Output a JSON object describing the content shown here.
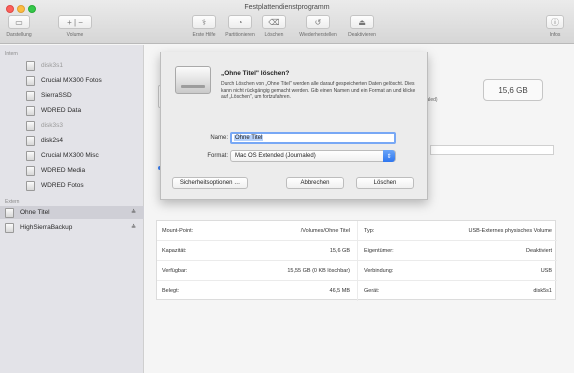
{
  "window": {
    "title": "Festplattendienstprogramm"
  },
  "toolbar": {
    "left": [
      {
        "name": "darstellung",
        "label": "Darstellung",
        "icon": "sidebar-icon"
      },
      {
        "name": "volume",
        "label": "Volume",
        "icon": "plus-minus-icon"
      }
    ],
    "center": [
      {
        "name": "erste-hilfe",
        "label": "Erste Hilfe",
        "icon": "stethoscope-icon"
      },
      {
        "name": "partitionieren",
        "label": "Partitionieren",
        "icon": "pie-icon"
      },
      {
        "name": "loeschen",
        "label": "Löschen",
        "icon": "eraser-icon"
      },
      {
        "name": "wiederherstellen",
        "label": "Wiederherstellen",
        "icon": "restore-icon"
      },
      {
        "name": "deaktivieren",
        "label": "Deaktivieren",
        "icon": "eject-icon"
      }
    ],
    "right": [
      {
        "name": "infos",
        "label": "Infos",
        "icon": "info-icon"
      }
    ]
  },
  "sidebar": {
    "intern_header": "Intern",
    "extern_header": "Extern",
    "intern_items": [
      {
        "label": "disk3s1",
        "dim": true
      },
      {
        "label": "Crucial MX300 Fotos",
        "dim": false
      },
      {
        "label": "SierraSSD",
        "dim": false
      },
      {
        "label": "WDRED Data",
        "dim": false
      },
      {
        "label": "disk3s3",
        "dim": true
      },
      {
        "label": "disk2s4",
        "dim": false
      },
      {
        "label": "Crucial MX300 Misc",
        "dim": false
      },
      {
        "label": "WDRED Media",
        "dim": false
      },
      {
        "label": "WDRED Fotos",
        "dim": false
      }
    ],
    "extern_items": [
      {
        "label": "Ohne Titel",
        "selected": true,
        "eject": "≜"
      },
      {
        "label": "HighSierraBackup",
        "selected": false,
        "eject": "≜"
      }
    ]
  },
  "volume_summary": {
    "capacity": "15,6 GB",
    "format_fragment": "rnaled)"
  },
  "info_table": {
    "left": [
      {
        "label": "Mount-Point:",
        "value": "/Volumes/Ohne Titel"
      },
      {
        "label": "Kapazität:",
        "value": "15,6 GB"
      },
      {
        "label": "Verfügbar:",
        "value": "15,55 GB (0 KB löschbar)"
      },
      {
        "label": "Belegt:",
        "value": "46,5 MB"
      }
    ],
    "right": [
      {
        "label": "Typ:",
        "value": "USB-Externes physisches Volume"
      },
      {
        "label": "Eigentümer:",
        "value": "Deaktiviert"
      },
      {
        "label": "Verbindung:",
        "value": "USB"
      },
      {
        "label": "Gerät:",
        "value": "disk5s1"
      }
    ]
  },
  "sheet": {
    "title": "„Ohne Titel\" löschen?",
    "body": "Durch Löschen von „Ohne Titel\" werden alle darauf gespeicherten Daten gelöscht. Dies kann nicht rückgängig gemacht werden. Gib einen Namen und ein Format an und klicke auf „Löschen\", um fortzufahren.",
    "name_label": "Name:",
    "name_value": "Ohne Titel",
    "format_label": "Format:",
    "format_value": "Mac OS Extended (Journaled)",
    "security_button": "Sicherheitsoptionen …",
    "cancel_button": "Abbrechen",
    "erase_button": "Löschen"
  },
  "colors": {
    "accent": "#3b82f6",
    "selection": "#b7d2fb"
  }
}
